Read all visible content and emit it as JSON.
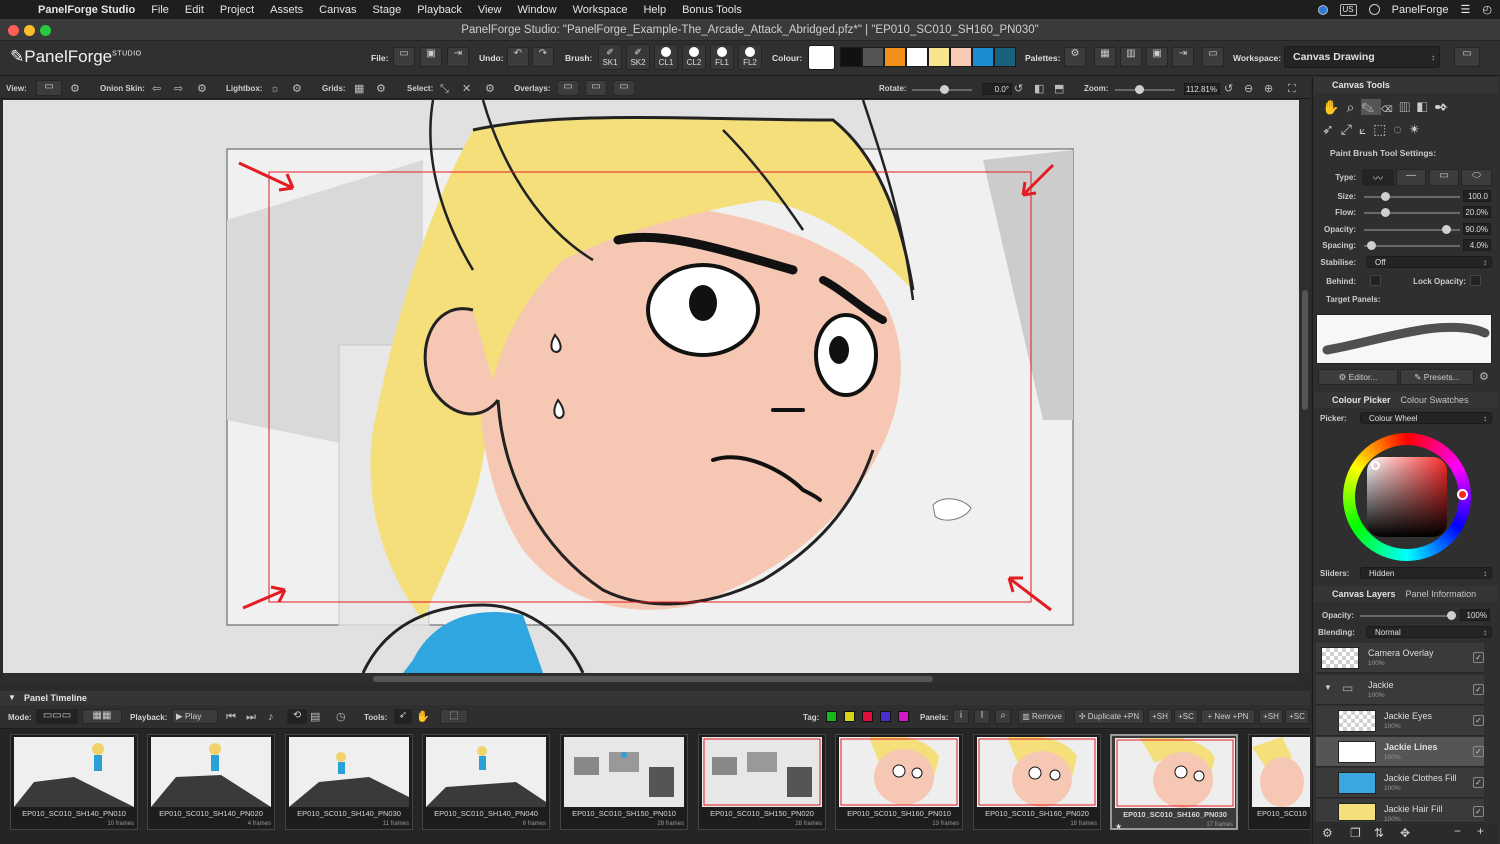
{
  "menubar": {
    "app": "PanelForge Studio",
    "items": [
      "File",
      "Edit",
      "Project",
      "Assets",
      "Canvas",
      "Stage",
      "Playback",
      "View",
      "Window",
      "Workspace",
      "Help",
      "Bonus Tools"
    ],
    "input_source": "US",
    "user": "PanelForge"
  },
  "window": {
    "title": "PanelForge Studio: \"PanelForge_Example-The_Arcade_Attack_Abridged.pfz*\" | \"EP010_SC010_SH160_PN030\""
  },
  "logo": {
    "name": "PanelForge",
    "sup": "STUDIO"
  },
  "toolbar": {
    "file": "File:",
    "undo": "Undo:",
    "brush": "Brush:",
    "brushes": [
      "SK1",
      "SK2",
      "CL1",
      "CL2",
      "FL1",
      "FL2"
    ],
    "colour": "Colour:",
    "swatches": [
      "#ffffff",
      "#111111",
      "#555555",
      "#f39019",
      "#ffffff",
      "#f6e58d",
      "#f8c9b4",
      "#1b8ccf",
      "#17617c"
    ],
    "palettes": "Palettes:",
    "workspace": "Workspace:",
    "workspace_value": "Canvas Drawing"
  },
  "options": {
    "view": "View:",
    "onion": "Onion Skin:",
    "lightbox": "Lightbox:",
    "grids": "Grids:",
    "select": "Select:",
    "overlays": "Overlays:",
    "rotate": "Rotate:",
    "rotate_value": "0.0°",
    "zoom": "Zoom:",
    "zoom_value": "112.81%"
  },
  "canvas_tools": {
    "title": "Canvas Tools",
    "settings_title": "Paint Brush Tool Settings:",
    "type": "Type:",
    "size": "Size:",
    "size_value": "100.0",
    "flow": "Flow:",
    "flow_value": "20.0%",
    "opacity": "Opacity:",
    "opacity_value": "90.0%",
    "spacing": "Spacing:",
    "spacing_value": "4.0%",
    "stabilise": "Stabilise:",
    "stabilise_value": "Off",
    "behind": "Behind:",
    "lock_opacity": "Lock Opacity:",
    "target_panels": "Target Panels:",
    "editor": "Editor...",
    "presets": "Presets..."
  },
  "levels": {
    "size": 0.2,
    "flow": 0.2,
    "opacity": 0.9,
    "spacing": 0.04
  },
  "colour": {
    "tab1": "Colour Picker",
    "tab2": "Colour Swatches",
    "picker": "Picker:",
    "picker_value": "Colour Wheel",
    "sliders": "Sliders:",
    "sliders_value": "Hidden"
  },
  "layers": {
    "tab1": "Canvas Layers",
    "tab2": "Panel Information",
    "opacity": "Opacity:",
    "opacity_value": "100%",
    "blending": "Blending:",
    "blending_value": "Normal",
    "items": [
      {
        "name": "Camera Overlay",
        "pct": "100%"
      },
      {
        "name": "Jackie",
        "pct": "100%"
      },
      {
        "name": "Jackie Eyes",
        "pct": "100%"
      },
      {
        "name": "Jackie Lines",
        "pct": "100%"
      },
      {
        "name": "Jackie Clothes Fill",
        "pct": "100%"
      },
      {
        "name": "Jackie Hair Fill",
        "pct": "100%"
      }
    ]
  },
  "timeline": {
    "title": "Panel Timeline",
    "mode": "Mode:",
    "playback": "Playback:",
    "play": "Play",
    "tools": "Tools:",
    "tag": "Tag:",
    "tag_colors": [
      "#16b81b",
      "#d8d418",
      "#e0103b",
      "#4a2fd0",
      "#d516c8"
    ],
    "panels": "Panels:",
    "remove": "Remove",
    "duplicate": "Duplicate",
    "plus_pn": "+PN",
    "plus_sh": "+SH",
    "plus_sc": "+SC",
    "new": "New",
    "frames": [
      {
        "name": "EP010_SC010_SH140_PN010",
        "frames": "10 frames"
      },
      {
        "name": "EP010_SC010_SH140_PN020",
        "frames": "4 frames"
      },
      {
        "name": "EP010_SC010_SH140_PN030",
        "frames": "11 frames"
      },
      {
        "name": "EP010_SC010_SH140_PN040",
        "frames": "6 frames"
      },
      {
        "name": "EP010_SC010_SH150_PN010",
        "frames": "28 frames"
      },
      {
        "name": "EP010_SC010_SH150_PN020",
        "frames": "28 frames"
      },
      {
        "name": "EP010_SC010_SH160_PN010",
        "frames": "13 frames"
      },
      {
        "name": "EP010_SC010_SH160_PN020",
        "frames": "18 frames"
      },
      {
        "name": "EP010_SC010_SH160_PN030",
        "frames": "17 frames"
      },
      {
        "name": "EP010_SC010",
        "frames": ""
      }
    ]
  }
}
